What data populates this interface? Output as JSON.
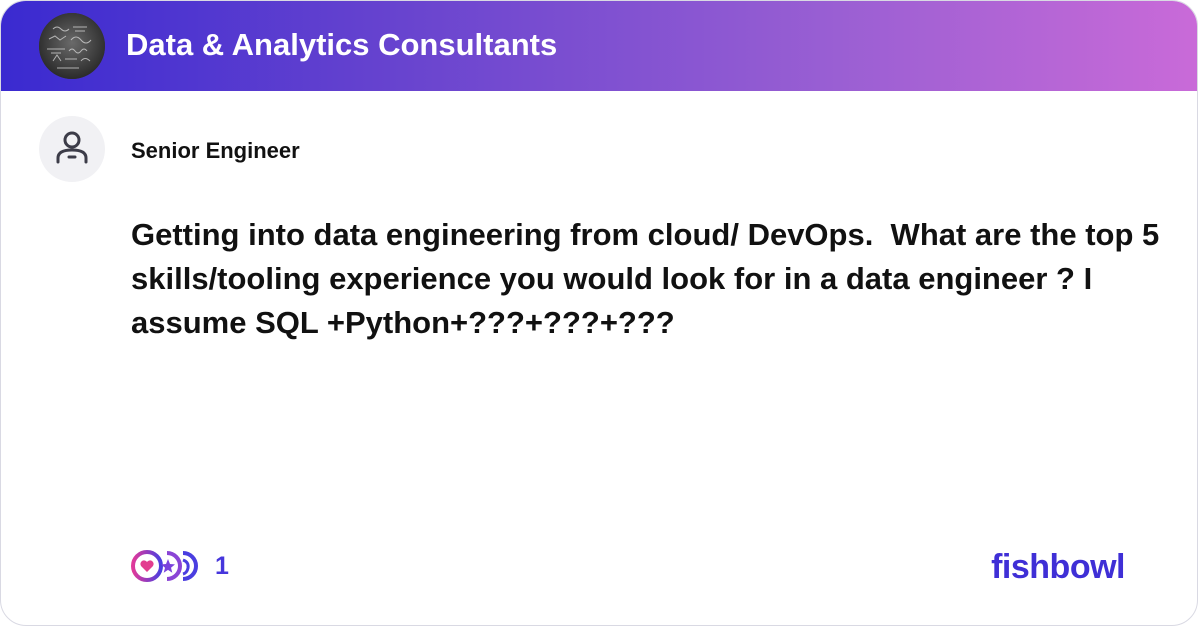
{
  "header": {
    "bowl_name": "Data & Analytics Consultants",
    "gradient_start": "#3a2ad0",
    "gradient_end": "#c96ad8",
    "avatar_icon": "chalkboard-equations-photo"
  },
  "post": {
    "author_title": "Senior Engineer",
    "author_icon": "user-icon",
    "text": "Getting into data engineering from cloud/ DevOps.  What are the top 5 skills/tooling experience you would look for in a data engineer ? I assume SQL +Python+???+???+???"
  },
  "footer": {
    "reaction_icons": [
      "heart-reaction-icon",
      "star-reaction-icon",
      "clap-reaction-icon"
    ],
    "reaction_count": "1",
    "brand": "fishbowl",
    "brand_color": "#3f2fd6",
    "accent_color": "#4636dc"
  }
}
